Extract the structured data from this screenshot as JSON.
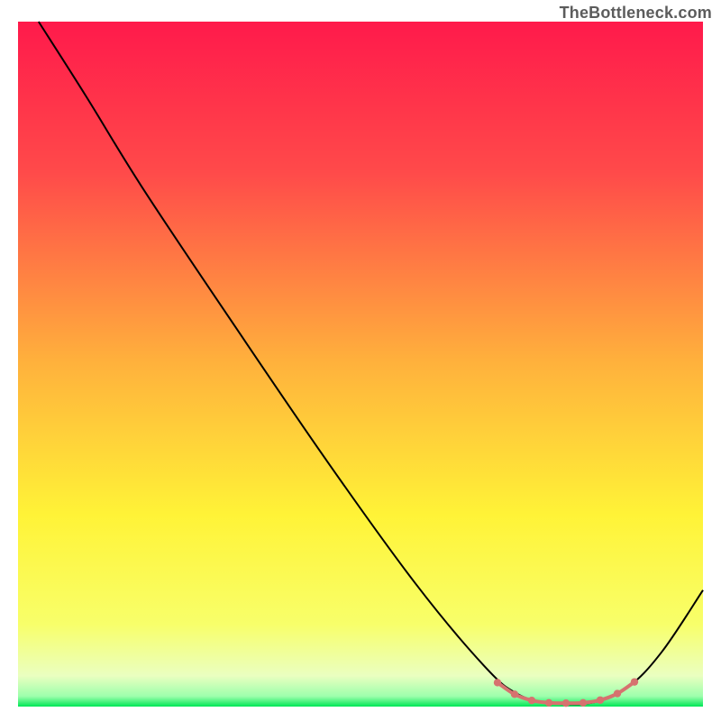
{
  "attribution": "TheBottleneck.com",
  "chart_data": {
    "type": "line",
    "title": "",
    "xlabel": "",
    "ylabel": "",
    "xlim": [
      0,
      100
    ],
    "ylim": [
      0,
      100
    ],
    "grid": false,
    "legend": false,
    "gradient_stops": [
      {
        "offset": 0,
        "color": "#ff1a4b"
      },
      {
        "offset": 0.22,
        "color": "#ff4a4a"
      },
      {
        "offset": 0.5,
        "color": "#ffb23c"
      },
      {
        "offset": 0.72,
        "color": "#fff337"
      },
      {
        "offset": 0.88,
        "color": "#f8ff6a"
      },
      {
        "offset": 0.955,
        "color": "#eaffc0"
      },
      {
        "offset": 0.985,
        "color": "#9dffac"
      },
      {
        "offset": 1.0,
        "color": "#00e756"
      }
    ],
    "series": [
      {
        "name": "bottleneck-curve",
        "color": "#000000",
        "points": [
          {
            "x": 3.0,
            "y": 100.0
          },
          {
            "x": 10.0,
            "y": 89.0
          },
          {
            "x": 18.0,
            "y": 76.0
          },
          {
            "x": 30.0,
            "y": 58.0
          },
          {
            "x": 45.0,
            "y": 36.0
          },
          {
            "x": 58.0,
            "y": 18.0
          },
          {
            "x": 68.0,
            "y": 6.0
          },
          {
            "x": 73.0,
            "y": 1.8
          },
          {
            "x": 78.0,
            "y": 0.5
          },
          {
            "x": 84.0,
            "y": 0.6
          },
          {
            "x": 89.0,
            "y": 2.8
          },
          {
            "x": 94.0,
            "y": 8.0
          },
          {
            "x": 100.0,
            "y": 17.0
          }
        ]
      },
      {
        "name": "optimal-band-marker",
        "color": "#d6726f",
        "points": [
          {
            "x": 70.0,
            "y": 3.5
          },
          {
            "x": 72.5,
            "y": 1.8
          },
          {
            "x": 75.0,
            "y": 0.9
          },
          {
            "x": 77.5,
            "y": 0.55
          },
          {
            "x": 80.0,
            "y": 0.5
          },
          {
            "x": 82.5,
            "y": 0.55
          },
          {
            "x": 85.0,
            "y": 0.95
          },
          {
            "x": 87.5,
            "y": 1.9
          },
          {
            "x": 90.0,
            "y": 3.6
          }
        ]
      }
    ],
    "annotations": []
  }
}
